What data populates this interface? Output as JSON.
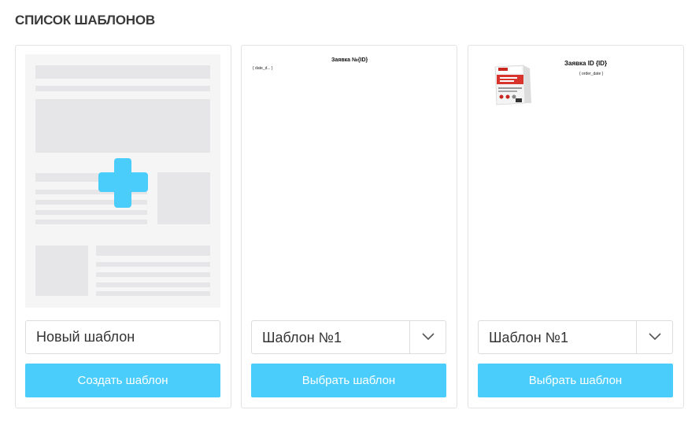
{
  "page": {
    "title": "СПИСОК ШАБЛОНОВ"
  },
  "colors": {
    "accent": "#4bcdfb",
    "wireframe_bg": "#f5f5f6",
    "wireframe_block": "#e6e6e8",
    "border": "#e3e3e3"
  },
  "cards": [
    {
      "preview": {
        "icon": "plus-icon"
      },
      "input": {
        "value": "Новый шаблон"
      },
      "button": {
        "label": "Создать шаблон"
      }
    },
    {
      "preview": {
        "doc_title": "Заявка №{ID}",
        "doc_sub": "{ date_d... }"
      },
      "select": {
        "value": "Шаблон №1",
        "icon": "chevron-down-icon"
      },
      "button": {
        "label": "Выбрать шаблон"
      }
    },
    {
      "preview": {
        "doc_title": "Заявка ID {ID}",
        "doc_sub": "{ order_date }",
        "image": "product-package-image"
      },
      "select": {
        "value": "Шаблон №1",
        "icon": "chevron-down-icon"
      },
      "button": {
        "label": "Выбрать шаблон"
      }
    }
  ]
}
